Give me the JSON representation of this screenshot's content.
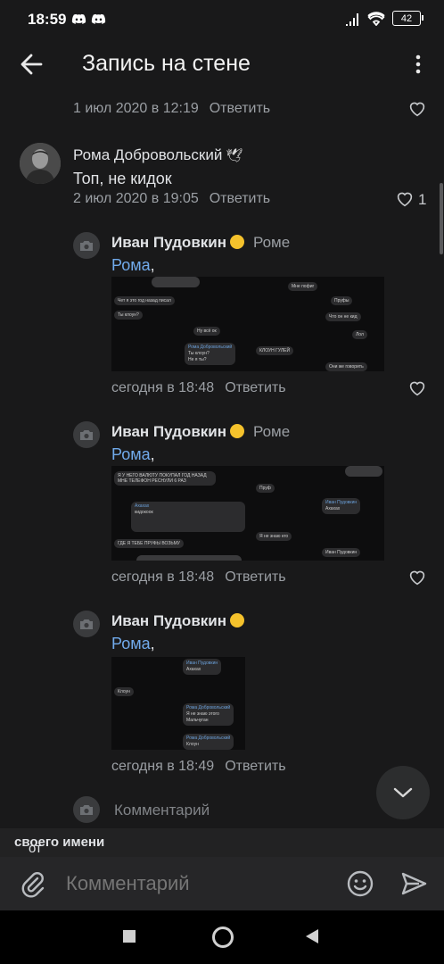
{
  "status_bar": {
    "time": "18:59",
    "battery": "42"
  },
  "header": {
    "title": "Запись на стене"
  },
  "comments": [
    {
      "date": "1 июл 2020 в 12:19",
      "reply": "Ответить"
    },
    {
      "author": "Рома Добровольский",
      "badge": "🕊",
      "text": "Топ, не кидок",
      "date": "2 июл 2020 в 19:05",
      "reply": "Ответить",
      "likes": "1"
    },
    {
      "author": "Иван Пудовкин",
      "reply_to": "Роме",
      "mention": "Рома",
      "date": "сегодня в 18:48",
      "reply": "Ответить"
    },
    {
      "author": "Иван Пудовкин",
      "reply_to": "Роме",
      "mention": "Рома",
      "date": "сегодня в 18:48",
      "reply": "Ответить"
    },
    {
      "author": "Иван Пудовкин",
      "mention": "Рома",
      "date": "сегодня в 18:49",
      "reply": "Ответить"
    }
  ],
  "screenshots": {
    "shot1": [
      "Мне пофиг",
      "Чет я это год назад писал",
      "Пруфы",
      "Ты клоун?",
      "Что он не кид",
      "Ну всё ок",
      "Лол",
      "Рома Добровольский",
      "Ты клоун?",
      "Не я ты?",
      "КЛОУН ГУЛЕЙ",
      "Они же говорить"
    ],
    "shot2": [
      "Я У НЕГО ВАЛЮТУ ПОКУПАЛ ГОД НАЗАД МНЕ ТЕЛЕФОН РЕСНУЛИ 6 РАЗ",
      "Пруф",
      "Ахахах",
      "кидокоок",
      "Иван Пудовкин",
      "Ахахах",
      "Я не знаю его",
      "ГДЕ Я ТЕБЕ ПРУФЫ ВОЗЬМУ",
      "Иван Пудовкин"
    ],
    "shot3": [
      "Иван Пудовкин",
      "Ахахах",
      "Клоун",
      "Рома Добровольский",
      "Я не знаю этого",
      "Мальчуган",
      "Рома Добровольский",
      "Клоун"
    ]
  },
  "comment_field": {
    "placeholder": "Комментарий"
  },
  "identity": {
    "prefix": "от",
    "name": "своего имени"
  },
  "composer": {
    "placeholder": "Комментарий"
  }
}
